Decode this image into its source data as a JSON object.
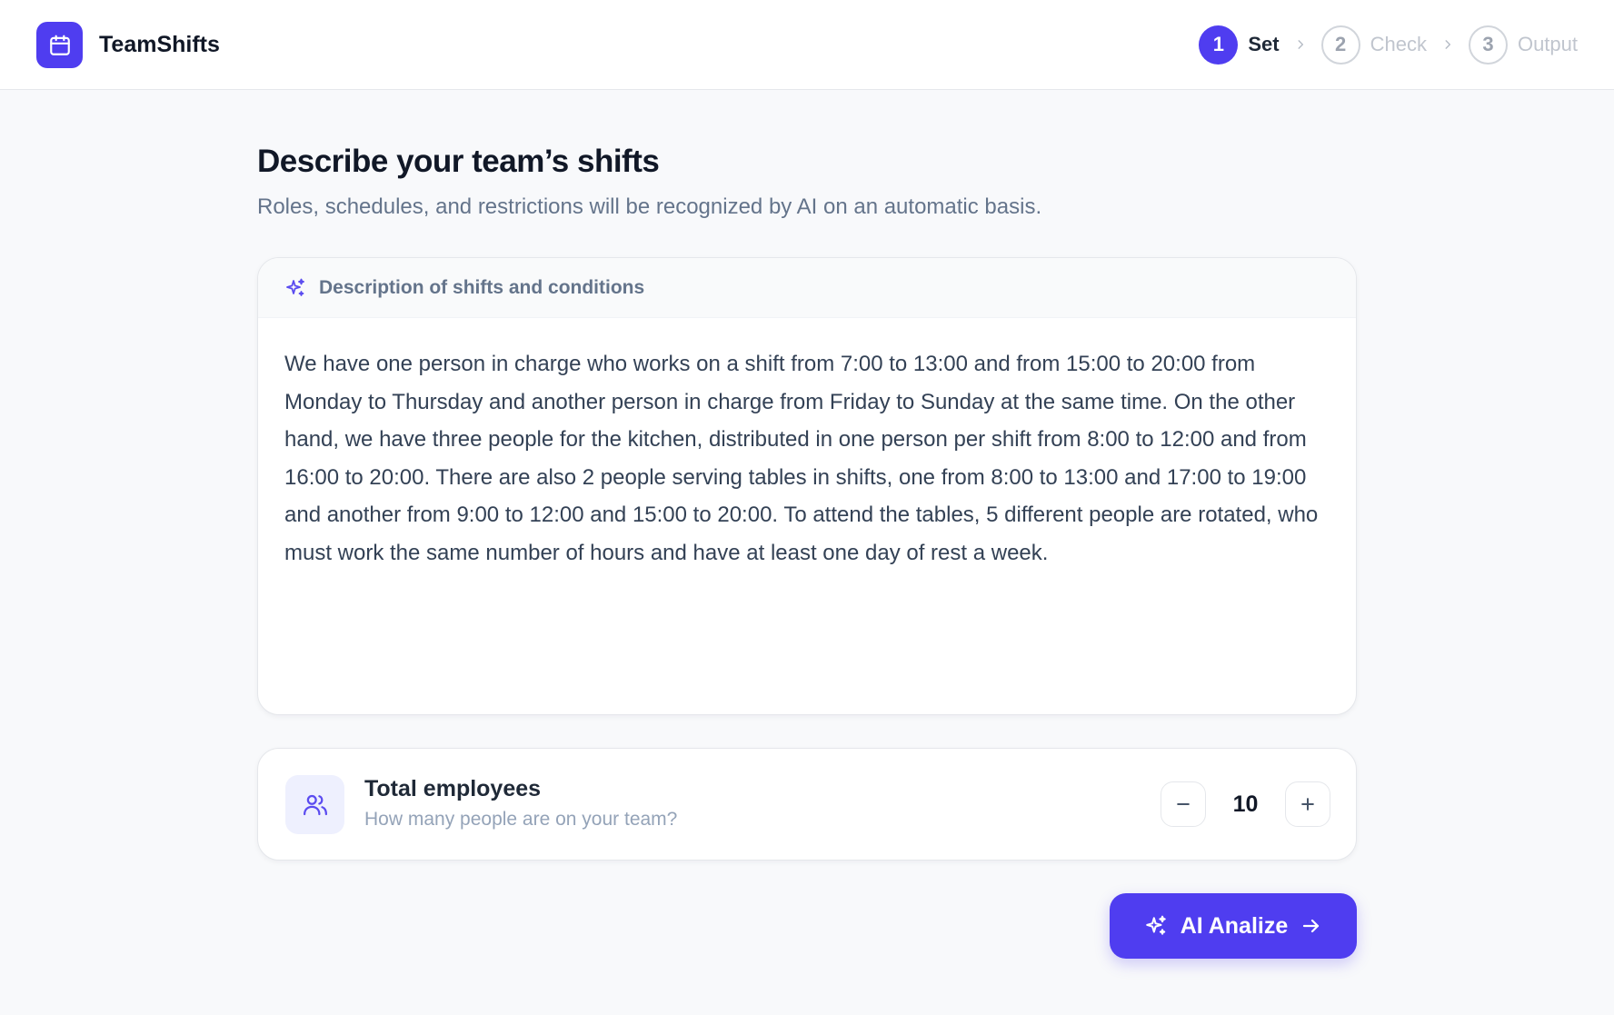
{
  "app": {
    "name": "TeamShifts"
  },
  "steps": [
    {
      "num": "1",
      "label": "Set",
      "state": "active"
    },
    {
      "num": "2",
      "label": "Check",
      "state": "inactive"
    },
    {
      "num": "3",
      "label": "Output",
      "state": "inactive"
    }
  ],
  "main": {
    "title": "Describe your team’s shifts",
    "subtitle": "Roles, schedules, and restrictions will be recognized by AI on an automatic basis."
  },
  "description": {
    "label": "Description of shifts and conditions",
    "value": "We have one person in charge who works on a shift from 7:00 to 13:00 and from 15:00 to 20:00 from Monday to Thursday and another person in charge from Friday to Sunday at the same time. On the other hand, we have three people for the kitchen, distributed in one person per shift from 8:00 to 12:00 and from 16:00 to 20:00. There are also 2 people serving tables in shifts, one from 8:00 to 13:00 and 17:00 to 19:00 and another from 9:00 to 12:00 and 15:00 to 20:00. To attend the tables, 5 different people are rotated, who must work the same number of hours and have at least one day of rest a week."
  },
  "employees": {
    "title": "Total employees",
    "subtitle": "How many people are on your team?",
    "count": "10"
  },
  "actions": {
    "analyze_label": "AI Analize"
  },
  "colors": {
    "accent": "#4f3df0",
    "muted": "#64748b",
    "background": "#f8f9fb"
  },
  "icons": {
    "logo": "calendar-icon",
    "description": "sparkles-icon",
    "employees": "users-icon",
    "decrement": "minus-icon",
    "increment": "plus-icon",
    "analyze": "sparkles-icon",
    "analyze_arrow": "arrow-right-icon",
    "step_separator": "chevron-right-icon"
  }
}
